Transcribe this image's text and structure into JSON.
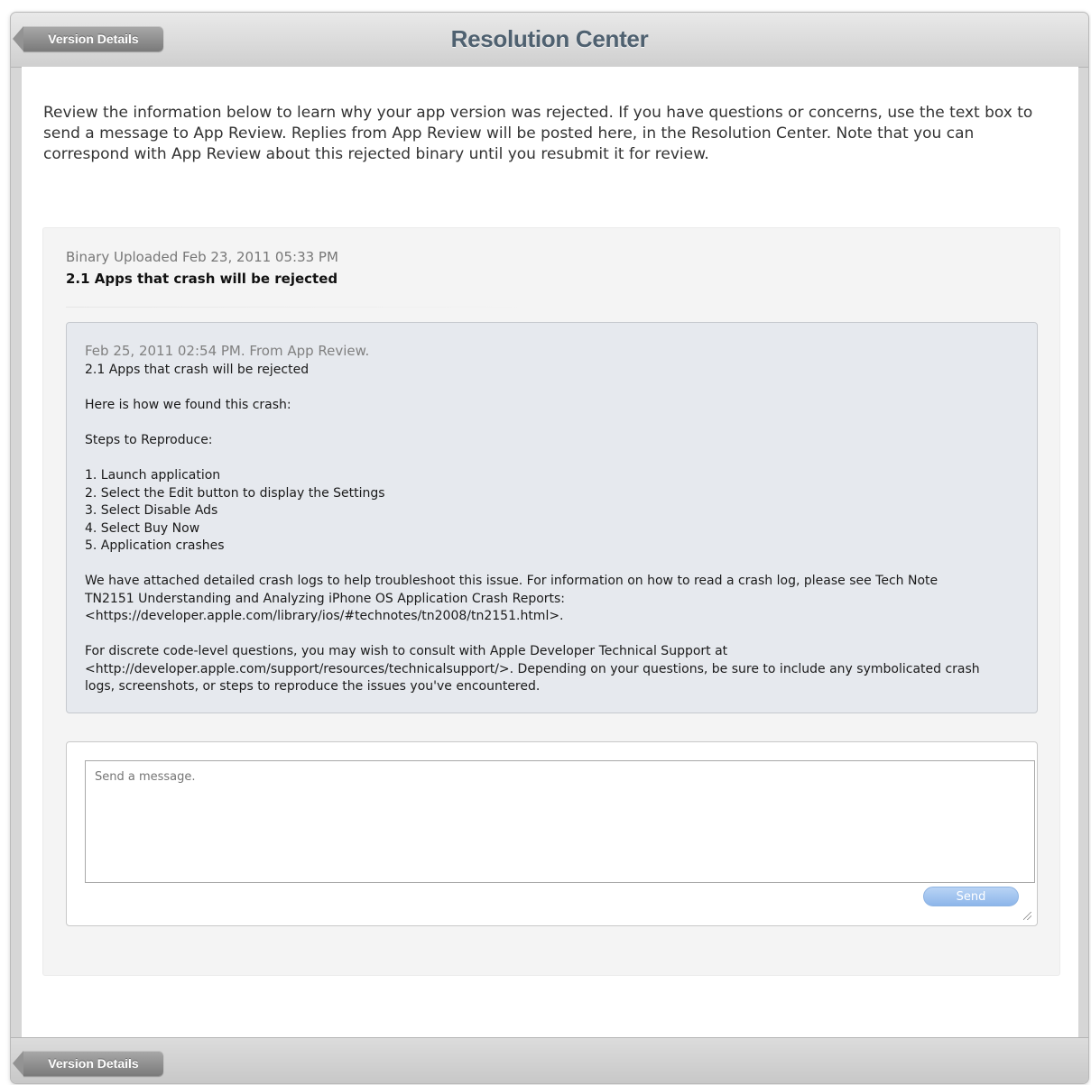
{
  "header": {
    "back_label": "Version Details",
    "title": "Resolution Center"
  },
  "intro": "Review the information below to learn why your app version was rejected. If you have questions or concerns, use the text box to send a message to App Review. Replies from App Review will be posted here, in the Resolution Center. Note that you can correspond with App Review about this rejected binary until you resubmit it for review.",
  "binary": {
    "uploaded": "Binary Uploaded Feb 23, 2011 05:33 PM",
    "guideline": "2.1 Apps that crash will be rejected"
  },
  "message": {
    "header": "Feb 25, 2011 02:54 PM. From App Review.",
    "body": "2.1 Apps that crash will be rejected\n\nHere is how we found this crash:\n\nSteps to Reproduce:\n\n1. Launch application\n2. Select the Edit button to display the Settings\n3. Select Disable Ads\n4. Select Buy Now\n5. Application crashes\n\nWe have attached detailed crash logs to help troubleshoot this issue. For information on how to read a crash log, please see Tech Note\nTN2151 Understanding and Analyzing iPhone OS Application Crash Reports:\n<https://developer.apple.com/library/ios/#technotes/tn2008/tn2151.html>.\n\nFor discrete code-level questions, you may wish to consult with Apple Developer Technical Support at\n<http://developer.apple.com/support/resources/technicalsupport/>. Depending on your questions, be sure to include any symbolicated crash\nlogs, screenshots, or steps to reproduce the issues you've encountered."
  },
  "reply": {
    "placeholder": "Send a message.",
    "value": "",
    "send_label": "Send"
  },
  "footer": {
    "back_label": "Version Details"
  }
}
